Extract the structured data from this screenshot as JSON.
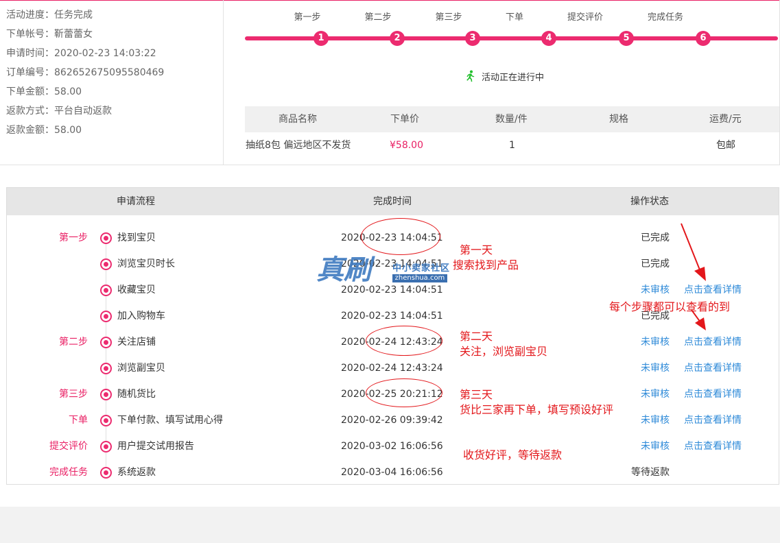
{
  "order_info": [
    {
      "label": "活动进度：",
      "value": "任务完成"
    },
    {
      "label": "下单帐号：",
      "value": "靳蕾蕾女"
    },
    {
      "label": "申请时间：",
      "value": "2020-02-23 14:03:22"
    },
    {
      "label": "订单编号：",
      "value": "862652675095580469"
    },
    {
      "label": "下单金额：",
      "value": "58.00"
    },
    {
      "label": "返款方式：",
      "value": "平台自动返款"
    },
    {
      "label": "返款金额：",
      "value": "58.00"
    }
  ],
  "progress": {
    "steps": [
      {
        "label": "第一步",
        "num": "1"
      },
      {
        "label": "第二步",
        "num": "2"
      },
      {
        "label": "第三步",
        "num": "3"
      },
      {
        "label": "下单",
        "num": "4"
      },
      {
        "label": "提交评价",
        "num": "5"
      },
      {
        "label": "完成任务",
        "num": "6"
      }
    ],
    "status_icon": "running-person-icon",
    "status_text": "活动正在进行中"
  },
  "product_table": {
    "headers": [
      "商品名称",
      "下单价",
      "数量/件",
      "规格",
      "运费/元"
    ],
    "row": {
      "name": "抽纸8包 偏远地区不发货",
      "price": "¥58.00",
      "qty": "1",
      "spec": "",
      "shipping": "包邮"
    }
  },
  "flow_table": {
    "headers": [
      "申请流程",
      "完成时间",
      "操作状态"
    ],
    "rows": [
      {
        "stage": "第一步",
        "name": "找到宝贝",
        "time": "2020-02-23 14:04:51",
        "status": "已完成",
        "link": ""
      },
      {
        "stage": "",
        "name": "浏览宝贝时长",
        "time": "2020-02-23 14:04:51",
        "status": "已完成",
        "link": ""
      },
      {
        "stage": "",
        "name": "收藏宝贝",
        "time": "2020-02-23 14:04:51",
        "status": "未审核",
        "link": "点击查看详情"
      },
      {
        "stage": "",
        "name": "加入购物车",
        "time": "2020-02-23 14:04:51",
        "status": "已完成",
        "link": ""
      },
      {
        "stage": "第二步",
        "name": "关注店铺",
        "time": "2020-02-24 12:43:24",
        "status": "未审核",
        "link": "点击查看详情"
      },
      {
        "stage": "",
        "name": "浏览副宝贝",
        "time": "2020-02-24 12:43:24",
        "status": "未审核",
        "link": "点击查看详情"
      },
      {
        "stage": "第三步",
        "name": "随机货比",
        "time": "2020-02-25 20:21:12",
        "status": "未审核",
        "link": "点击查看详情"
      },
      {
        "stage": "下单",
        "name": "下单付款、填写试用心得",
        "time": "2020-02-26 09:39:42",
        "status": "未审核",
        "link": "点击查看详情"
      },
      {
        "stage": "提交评价",
        "name": "用户提交试用报告",
        "time": "2020-03-02 16:06:56",
        "status": "未审核",
        "link": "点击查看详情"
      },
      {
        "stage": "完成任务",
        "name": "系统返款",
        "time": "2020-03-04 16:06:56",
        "status": "等待返款",
        "link": ""
      }
    ]
  },
  "annotations": {
    "day1_title": "第一天",
    "day1_desc": "搜索找到产品",
    "day2_title": "第二天",
    "day2_desc": "关注，浏览副宝贝",
    "day3_title": "第三天",
    "day3_desc": "货比三家再下单，填写预设好评",
    "review_note": "收货好评，等待返款",
    "detail_note": "每个步骤都可以查看的到"
  },
  "watermark": {
    "big": "真刷",
    "small": "中小卖家社区",
    "site": "zhenshua.com"
  },
  "colors": {
    "accent": "#ec2b6f",
    "link": "#2e8ad8",
    "annotation": "#e3171b",
    "status_icon": "#22c02d"
  }
}
